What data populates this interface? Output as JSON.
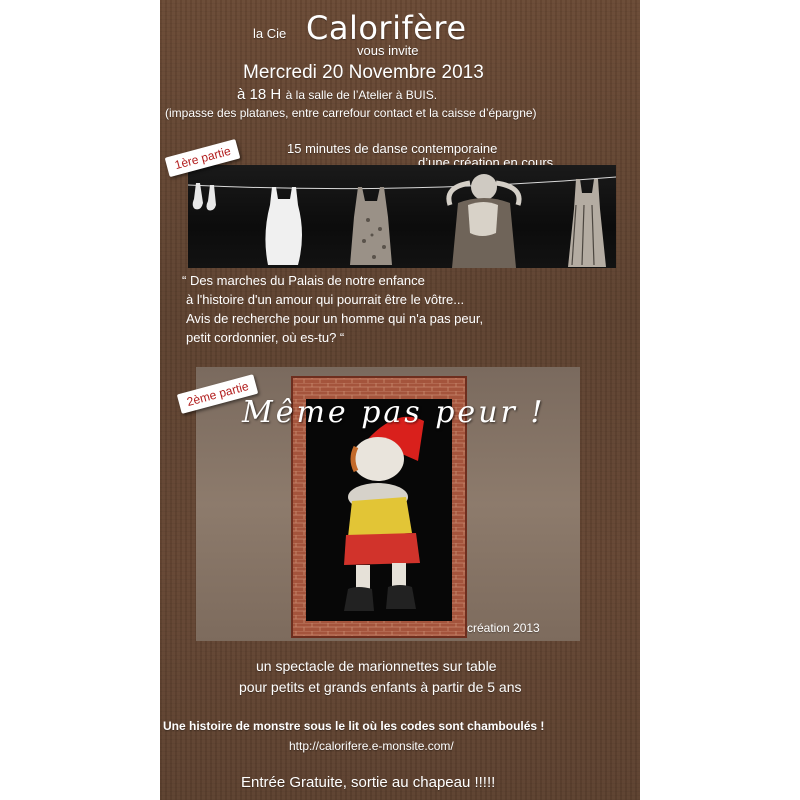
{
  "header": {
    "la_cie": "la Cie",
    "company": "Calorifère",
    "invite": "vous invite",
    "date": "Mercredi 20 Novembre 2013",
    "time": "à 18 H",
    "venue": "à la salle de l’Atelier à BUIS.",
    "address": "(impasse des platanes, entre carrefour contact et la caisse d’épargne)"
  },
  "part1": {
    "badge": "1ère partie",
    "line1": "15 minutes de danse contemporaine",
    "line2": "d’une création en cours",
    "quote": [
      "“ Des marches du Palais de notre enfance",
      "à l'histoire d'un amour qui pourrait être le vôtre...",
      "Avis de recherche pour un homme qui n'a pas peur,",
      "petit cordonnier, où es-tu? “"
    ]
  },
  "part2": {
    "badge": "2ème partie",
    "title": "Même pas peur !",
    "creation": "création 2013",
    "line1": "un spectacle de marionnettes sur table",
    "line2": "pour petits et grands enfants à partir de 5 ans"
  },
  "footer": {
    "story": "Une histoire de monstre sous le lit où les codes sont chamboulés !",
    "url": "http://calorifere.e-monsite.com/",
    "entree": "Entrée Gratuite, sortie au chapeau !!!!!"
  }
}
